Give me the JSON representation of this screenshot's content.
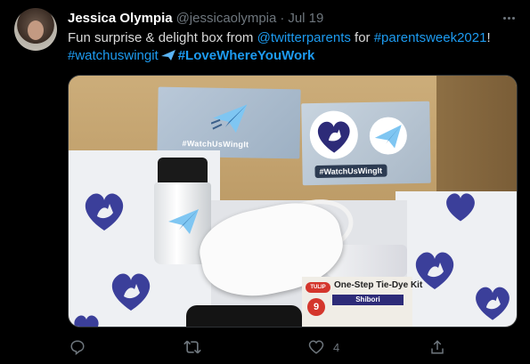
{
  "tweet": {
    "name": "Jessica Olympia",
    "handle": "@jessicaolympia",
    "separator": "·",
    "date": "Jul 19",
    "text_parts": {
      "p1": "Fun surprise & delight box from ",
      "mention": "@twitterparents",
      "p2": " for ",
      "hashtag1": "#parentsweek2021",
      "p3": "!",
      "hashtag2": "#watchuswingit",
      "hashtag3": "#LoveWhereYouWork"
    },
    "media": {
      "card_label": "#WatchUsWingIt",
      "sticker_label": "#WatchUsWingIt",
      "kit_brand": "TULIP",
      "kit_title": "One-Step Tie-Dye Kit",
      "kit_count": "9",
      "kit_variant": "Shibori"
    },
    "actions": {
      "reply_count": "",
      "retweet_count": "",
      "like_count": "4"
    }
  },
  "colors": {
    "background": "#000000",
    "link": "#1d9bf0",
    "muted": "#6e767d",
    "text": "#d9d9d9"
  },
  "icons": [
    "more-icon",
    "paper-plane-emoji",
    "reply-icon",
    "retweet-icon",
    "like-icon",
    "share-icon"
  ]
}
